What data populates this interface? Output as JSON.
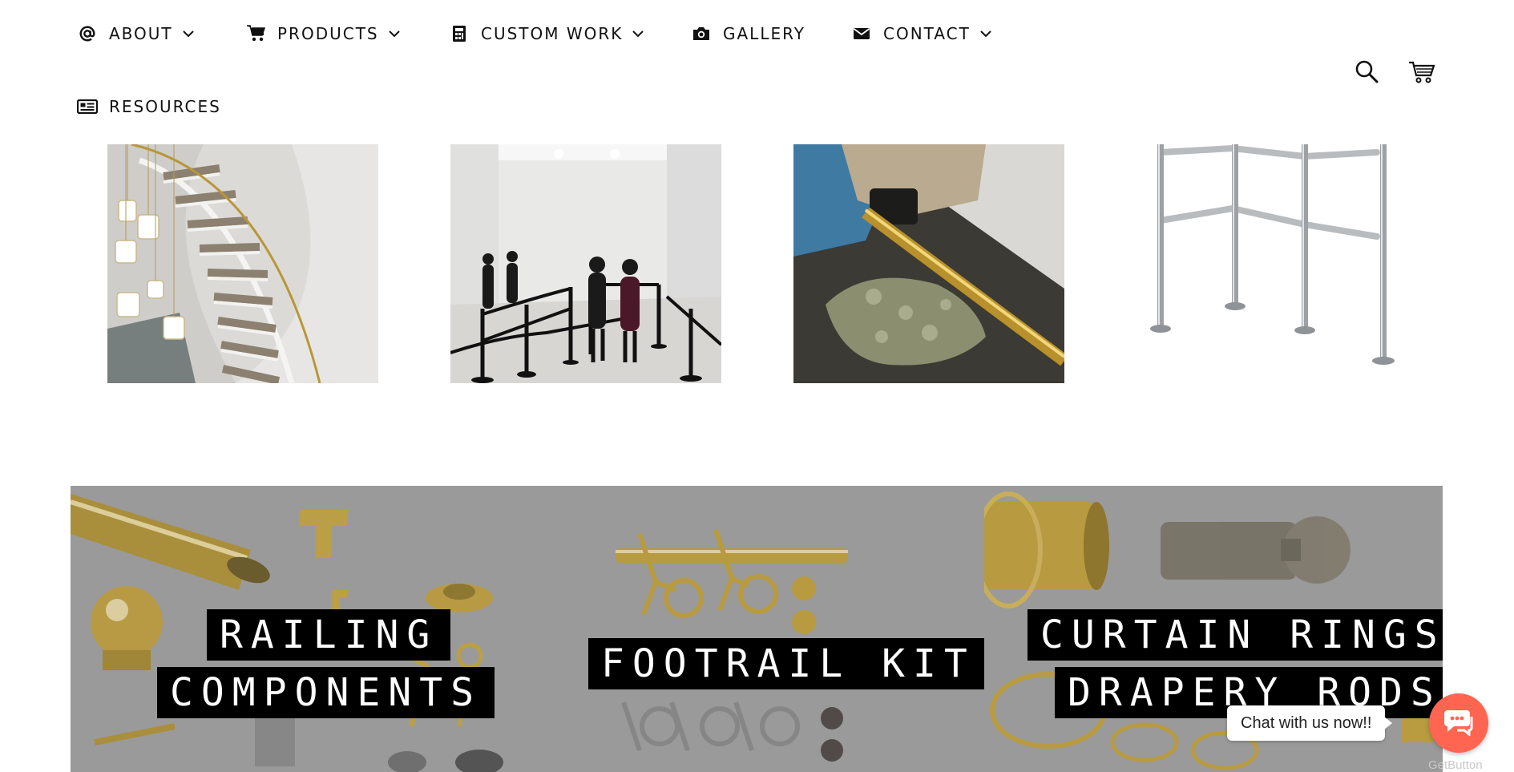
{
  "nav": {
    "items": [
      {
        "label": "ABOUT",
        "icon": "at-icon",
        "has_dropdown": true
      },
      {
        "label": "PRODUCTS",
        "icon": "cart-icon",
        "has_dropdown": true
      },
      {
        "label": "CUSTOM WORK",
        "icon": "calculator-icon",
        "has_dropdown": true
      },
      {
        "label": "GALLERY",
        "icon": "camera-icon",
        "has_dropdown": false
      },
      {
        "label": "CONTACT",
        "icon": "envelope-icon",
        "has_dropdown": true
      },
      {
        "label": "RESOURCES",
        "icon": "newspaper-icon",
        "has_dropdown": false
      }
    ],
    "actions": [
      {
        "name": "search",
        "icon": "search-icon"
      },
      {
        "name": "cart",
        "icon": "shopping-cart-icon"
      }
    ]
  },
  "gallery_strip": [
    {
      "subject": "spiral staircase with brass handrail",
      "icon": "photo-staircase"
    },
    {
      "subject": "gallery with black stanchion barriers",
      "icon": "photo-stanchions"
    },
    {
      "subject": "polishing brass tubing",
      "icon": "photo-polishing"
    },
    {
      "subject": "chrome railing posts",
      "icon": "photo-chrome-railing"
    }
  ],
  "collections": [
    {
      "lines": [
        "RAILING",
        "COMPONENTS"
      ]
    },
    {
      "lines": [
        "FOOTRAIL KIT"
      ]
    },
    {
      "lines": [
        "CURTAIN RINGS &",
        "DRAPERY RODS"
      ]
    }
  ],
  "chat": {
    "bubble_text": "Chat with us now!!",
    "powered_by": "GetButton"
  },
  "colors": {
    "banner_gray": "#9a9a9a",
    "label_bg": "#000000",
    "chat_button": "#ff6550",
    "brass": "#c9a227"
  }
}
